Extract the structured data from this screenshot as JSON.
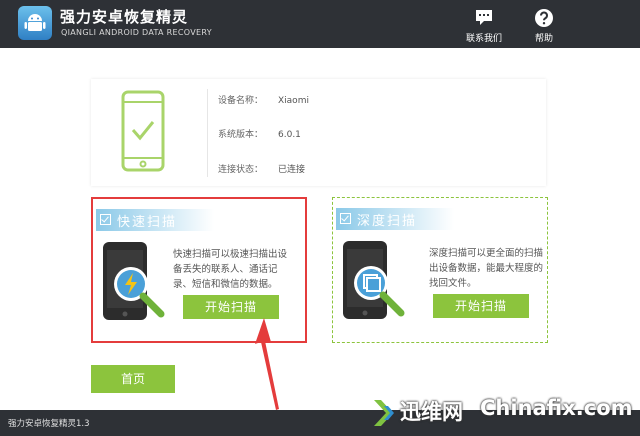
{
  "app": {
    "title": "强力安卓恢复精灵",
    "subtitle": "QIANGLI ANDROID DATA RECOVERY"
  },
  "top_buttons": {
    "contact_label": "联系我们",
    "help_label": "帮助"
  },
  "device": {
    "rows": [
      {
        "key": "设备名称：",
        "value": "Xiaomi"
      },
      {
        "key": "系统版本：",
        "value": "6.0.1"
      },
      {
        "key": "连接状态：",
        "value": "已连接"
      }
    ]
  },
  "quick_scan": {
    "title": "快速扫描",
    "description": "快速扫描可以极速扫描出设备丢失的联系人、通话记录、短信和微信的数据。",
    "button_label": "开始扫描"
  },
  "deep_scan": {
    "title": "深度扫描",
    "description": "深度扫描可以更全面的扫描出设备数据，能最大程度的找回文件。",
    "button_label": "开始扫描"
  },
  "home_button_label": "首页",
  "status_bar": {
    "text": "强力安卓恢复精灵1.3"
  },
  "watermark": {
    "cn": "迅维网",
    "en": "Chinafix.com"
  },
  "colors": {
    "titlebar": "#2e3136",
    "accent_green": "#8cc43d",
    "highlight_red": "#e43c3c",
    "header_blue": "#8bc9e8"
  }
}
